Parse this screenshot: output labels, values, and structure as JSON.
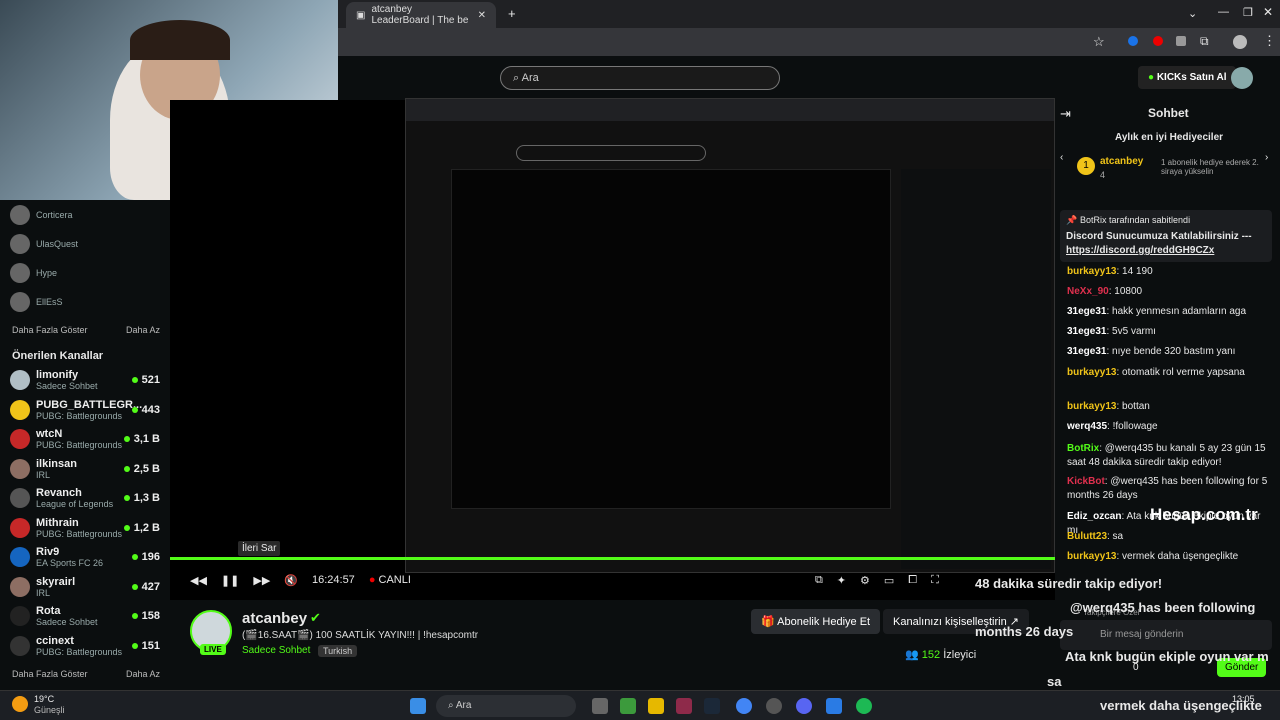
{
  "browser": {
    "tab_title": "atcanbey LeaderBoard | The be"
  },
  "kick": {
    "search_placeholder": "Ara",
    "buy_kicks": "KICKs Satın Al"
  },
  "sidebar": {
    "followed": [
      {
        "name": "Corticera"
      },
      {
        "name": "UlasQuest"
      },
      {
        "name": "Hype"
      },
      {
        "name": "EllEsS"
      }
    ],
    "show_more": "Daha Fazla Göster",
    "show_less": "Daha Az",
    "recommended_title": "Önerilen Kanallar",
    "recommended": [
      {
        "name": "limonify",
        "sub": "Sadece Sohbet",
        "viewers": "521"
      },
      {
        "name": "PUBG_BATTLEGR...",
        "sub": "PUBG: Battlegrounds",
        "viewers": "443"
      },
      {
        "name": "wtcN",
        "sub": "PUBG: Battlegrounds",
        "viewers": "3,1 B"
      },
      {
        "name": "ilkinsan",
        "sub": "IRL",
        "viewers": "2,5 B"
      },
      {
        "name": "Revanch",
        "sub": "League of Legends",
        "viewers": "1,3 B"
      },
      {
        "name": "Mithrain",
        "sub": "PUBG: Battlegrounds",
        "viewers": "1,2 B"
      },
      {
        "name": "Riv9",
        "sub": "EA Sports FC 26",
        "viewers": "196"
      },
      {
        "name": "skyrairl",
        "sub": "IRL",
        "viewers": "427"
      },
      {
        "name": "Rota",
        "sub": "Sadece Sohbet",
        "viewers": "158"
      },
      {
        "name": "ccinext",
        "sub": "PUBG: Battlegrounds",
        "viewers": "151"
      }
    ],
    "show_more2": "Daha Fazla Göster",
    "show_less2": "Daha Az"
  },
  "player": {
    "tooltip": "İleri Sar",
    "time": "16:24:57",
    "live": "CANLI",
    "progress": 1.0
  },
  "stream": {
    "channel": "atcanbey",
    "title": "(🎬16.SAAT🎬) 100 SAATLİK YAYIN!!! | !hesapcomtr",
    "category": "Sadece Sohbet",
    "tag": "Turkish",
    "live_badge": "LIVE",
    "sub_gift_btn": "Abonelik Hediye Et",
    "customize_btn": "Kanalınızı kişiselleştirin",
    "viewers": "152",
    "viewers_label": "İzleyici"
  },
  "chat": {
    "title": "Sohbet",
    "top_gifters": "Aylık en iyi Hediyeciler",
    "gifter_name": "atcanbey",
    "gifter_count": "4",
    "gifter_note": "1 abonelik hediye ederek 2. siraya yükselin",
    "pinned_by": "BotRix tarafından sabitlendi",
    "pinned_text": "Discord Sunucumuza Katılabilirsiniz --- ",
    "pinned_link": "https://discord.gg/reddGH9CZx",
    "messages": [
      {
        "user": "burkayy13",
        "text": ": 14 190",
        "color": "#f0c419"
      },
      {
        "user": "NeXx_90",
        "text": ": 10800",
        "color": "#e0304e"
      },
      {
        "user": "31ege31",
        "text": ": hakk yenmesın adamların aga",
        "color": "#fff"
      },
      {
        "user": "31ege31",
        "text": ": 5v5 varmı",
        "color": "#fff"
      },
      {
        "user": "31ege31",
        "text": ": nıye bende 320 bastım yanı",
        "color": "#fff"
      },
      {
        "user": "burkayy13",
        "text": ": otomatik rol verme yapsana",
        "color": "#f0c419"
      },
      {
        "user": "burkayy13",
        "text": ": bottan",
        "color": "#f0c419"
      },
      {
        "user": "werq435",
        "text": ": !followage",
        "color": "#fff"
      },
      {
        "user": "BotRix",
        "text": ": @werq435 bu kanalı 5 ay 23 gün 15 saat 48 dakika süredir takip ediyor!",
        "color": "#53fc18"
      },
      {
        "user": "KickBot",
        "text": ": @werq435 has been following for 5 months 26 days",
        "color": "#e0304e"
      },
      {
        "user": "Ediz_ozcan",
        "text": ": Ata knk bugün ekiple oyun var mı",
        "color": "#fff"
      },
      {
        "user": "Bulutt23",
        "text": ": sa",
        "color": "#f0c419"
      },
      {
        "user": "burkayy13",
        "text": ": vermek daha üşengeçlikte",
        "color": "#f0c419"
      }
    ],
    "input_placeholder": "Bir mesaj gönderin",
    "followers_only": "Takipçilere Özel",
    "send": "Gönder",
    "points": "0"
  },
  "overlay": {
    "brand": "Hesap.com.tr",
    "big1": "48 dakika süredir takip ediyor!",
    "big2": "@werq435 has been following",
    "big3": "months 26 days",
    "big4": "Ata knk bugün ekiple oyun var m",
    "big5": "sa",
    "big6": "vermek daha üşengeçlikte"
  },
  "taskbar": {
    "temp": "19°C",
    "weather": "Güneşli",
    "search": "Ara",
    "clock": "13:05"
  }
}
